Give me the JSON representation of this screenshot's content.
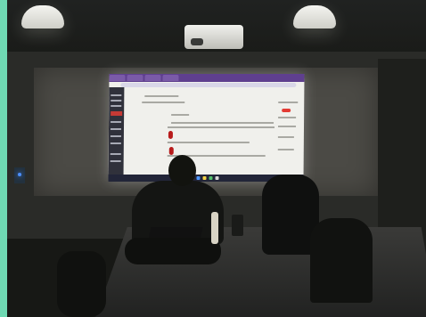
{
  "scene": {
    "background_color": "#171815",
    "accent_color": "#6fd9b3",
    "projector_screen": {
      "ui_colors": [
        "#f0f0ec",
        "#5f3f8f",
        "#c63a35",
        "#b81b1b",
        "#30313b"
      ]
    }
  }
}
